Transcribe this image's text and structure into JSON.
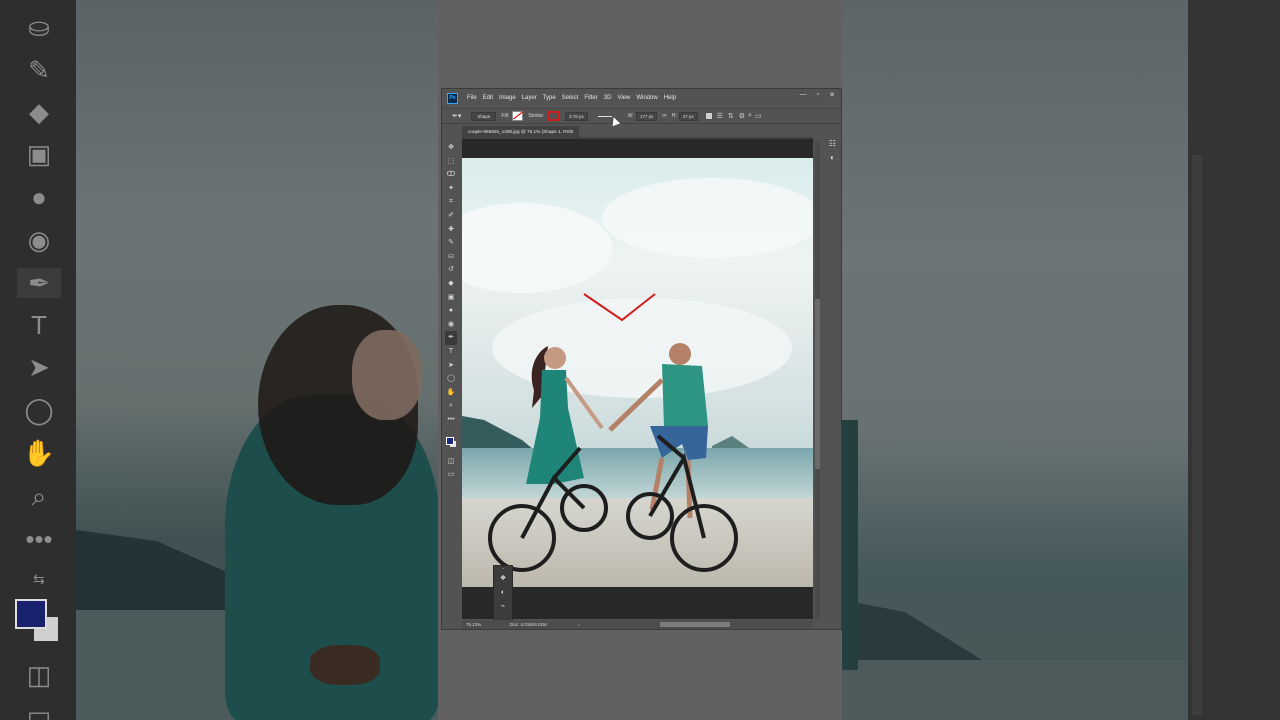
{
  "app": {
    "menu": [
      "File",
      "Edit",
      "Image",
      "Layer",
      "Type",
      "Select",
      "Filter",
      "3D",
      "View",
      "Window",
      "Help"
    ],
    "window_controls": {
      "minimize": "—",
      "restore": "▫",
      "close": "✕"
    }
  },
  "options_bar": {
    "mode": "Shape",
    "fill_label": "Fill:",
    "stroke_label": "Stroke:",
    "stroke_width": "3.78 px",
    "width_label": "W:",
    "width_value": "177 px",
    "height_label": "H:",
    "height_value": "47 px",
    "stroke_color": "#d21d1d"
  },
  "document": {
    "tab_title": "couple-955926_1280.jpg @ 75.1% (Shape 1, RGB"
  },
  "status": {
    "zoom": "75.13%",
    "doc_size": "Doc: 4.01M/4.01M",
    "arrow": "›"
  },
  "colors": {
    "foreground": "#1c2a88",
    "background": "#e6e6e6",
    "shape_stroke": "#d21d1d"
  },
  "icons": {
    "tools": [
      "move-icon",
      "marquee-icon",
      "lasso-icon",
      "quick-select-icon",
      "crop-icon",
      "eyedropper-icon",
      "healing-icon",
      "brush-icon",
      "stamp-icon",
      "history-brush-icon",
      "eraser-icon",
      "gradient-icon",
      "blur-icon",
      "dodge-icon",
      "pen-icon",
      "type-icon",
      "path-select-icon",
      "ellipse-icon",
      "hand-icon",
      "zoom-icon",
      "more-tools-icon"
    ]
  }
}
